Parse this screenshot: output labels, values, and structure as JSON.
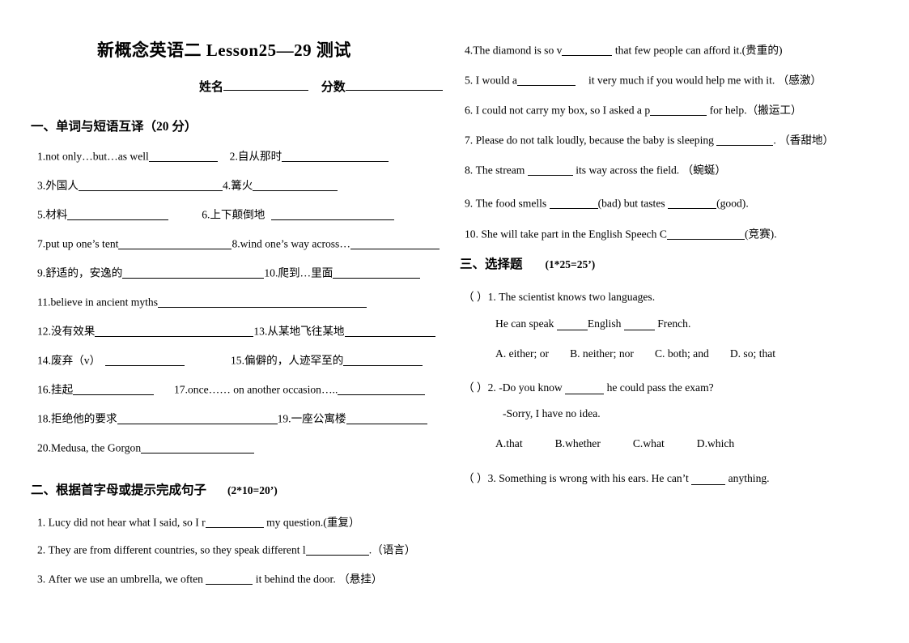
{
  "document": {
    "title": "新概念英语二 Lesson25—29 测试",
    "name_label": "姓名",
    "score_label": "分数"
  },
  "section1": {
    "heading": "一、单词与短语互译（20 分）",
    "items": [
      {
        "num": "1.",
        "text": "not only…but…as well"
      },
      {
        "num": "2.",
        "text": "自从那时"
      },
      {
        "num": "3.",
        "text": "外国人"
      },
      {
        "num": "4.",
        "text": "篝火"
      },
      {
        "num": "5.",
        "text": "材料"
      },
      {
        "num": "6.",
        "text": "上下颠倒地"
      },
      {
        "num": "7.",
        "text": "put up one’s tent"
      },
      {
        "num": "8.",
        "text": "wind one’s way across…"
      },
      {
        "num": "9.",
        "text": "舒适的，安逸的"
      },
      {
        "num": "10.",
        "text": "爬到…里面"
      },
      {
        "num": "11.",
        "text": "believe in ancient myths"
      },
      {
        "num": "12.",
        "text": "没有效果"
      },
      {
        "num": "13.",
        "text": "从某地飞往某地"
      },
      {
        "num": "14.",
        "text": "废弃（v）"
      },
      {
        "num": "15.",
        "text": "偏僻的，人迹罕至的"
      },
      {
        "num": "16.",
        "text": "挂起"
      },
      {
        "num": "17.",
        "text": "once…… on another occasion….."
      },
      {
        "num": "18.",
        "text": "拒绝他的要求"
      },
      {
        "num": "19.",
        "text": "一座公寓楼"
      },
      {
        "num": "20.",
        "text": "Medusa, the Gorgon"
      }
    ]
  },
  "section2": {
    "heading": "二、根据首字母或提示完成句子",
    "points": "(2*10=20’)",
    "items": [
      {
        "num": "1.",
        "pre": "Lucy did not hear what I said, so I r",
        "mid": "my question.(重复）",
        "post": ""
      },
      {
        "num": "2.",
        "pre": "They are from different countries, so they speak different l",
        "mid": ".（语言）",
        "post": ""
      },
      {
        "num": "3.",
        "pre": "After we use an umbrella, we often",
        "mid": "it behind the door. （悬挂）",
        "post": ""
      },
      {
        "num": "4.",
        "pre": "The diamond is so v",
        "mid": "that few people can afford it.(贵重的)",
        "post": ""
      },
      {
        "num": "5.",
        "pre": "I would a",
        "mid": "it very much if you would help me with it. （感激）",
        "post": ""
      },
      {
        "num": "6.",
        "pre": "I could not carry my box, so I asked a p",
        "mid": "for help.（搬运工）",
        "post": ""
      },
      {
        "num": "7.",
        "pre": "Please do not talk loudly, because the baby is sleeping",
        "mid": ". （香甜地）",
        "post": ""
      },
      {
        "num": "8.",
        "pre": "The stream",
        "mid": "its way across the field. （蜿蜒）",
        "post": ""
      },
      {
        "num": "9.",
        "pre": "The food smells",
        "mid": "(bad) but tastes",
        "post": "(good)."
      },
      {
        "num": "10.",
        "pre": "She will take part in the English Speech C",
        "mid": "(竞赛).",
        "post": ""
      }
    ]
  },
  "section3": {
    "heading": "三、选择题",
    "points": "(1*25=25’)",
    "questions": [
      {
        "bracket": "（ ）",
        "num": "1.",
        "stem": "The scientist knows two languages.",
        "sub_pre": "He can speak",
        "sub_mid": "English",
        "sub_post": "French.",
        "options": [
          "A. either; or",
          "B. neither; nor",
          "C. both; and",
          "D. so; that"
        ]
      },
      {
        "bracket": "（ ）",
        "num": "2.",
        "stem_pre": "-Do you know",
        "stem_post": "he could pass the exam?",
        "sub": "-Sorry, I have no idea.",
        "options": [
          "A.that",
          "B.whether",
          "C.what",
          "D.which"
        ]
      },
      {
        "bracket": "（ ）",
        "num": "3.",
        "stem_pre": "Something is wrong with his ears. He can’t",
        "stem_post": "anything."
      }
    ]
  }
}
